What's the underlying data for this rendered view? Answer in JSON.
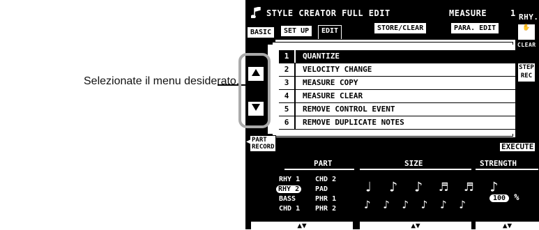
{
  "annotation": {
    "text": "Selezionate il menu desiderato."
  },
  "header": {
    "title": "STYLE CREATOR FULL EDIT",
    "measure_label": "MEASURE",
    "measure_value": "1"
  },
  "tabs": [
    {
      "label": "BASIC"
    },
    {
      "label": "SET UP"
    },
    {
      "label": "EDIT"
    },
    {
      "label": "STORE/CLEAR"
    },
    {
      "label": "PARA. EDIT"
    }
  ],
  "right_panel": {
    "rhy_label": "RHY.",
    "clear_label": "CLEAR",
    "step_rec_label": "STEP REC"
  },
  "menu": {
    "items": [
      {
        "num": "1",
        "label": "QUANTIZE"
      },
      {
        "num": "2",
        "label": "VELOCITY CHANGE"
      },
      {
        "num": "3",
        "label": "MEASURE COPY"
      },
      {
        "num": "4",
        "label": "MEASURE CLEAR"
      },
      {
        "num": "5",
        "label": "REMOVE CONTROL EVENT"
      },
      {
        "num": "6",
        "label": "REMOVE DUPLICATE NOTES"
      }
    ]
  },
  "buttons": {
    "part_record": "PART RECORD",
    "execute": "EXECUTE"
  },
  "bottom": {
    "headers": {
      "part": "PART",
      "size": "SIZE",
      "strength": "STRENGTH"
    },
    "parts": [
      "RHY 1",
      "CHD 2",
      "RHY 2",
      "PAD",
      "BASS",
      "PHR 1",
      "CHD 1",
      "PHR 2"
    ],
    "strength_value": "100",
    "strength_unit": "%",
    "note_row1": "♩ ♪ ♪ ♬ ♬ ♪",
    "note_row2": "♪ ♪ ♪ ♪ ♪ ♪"
  }
}
